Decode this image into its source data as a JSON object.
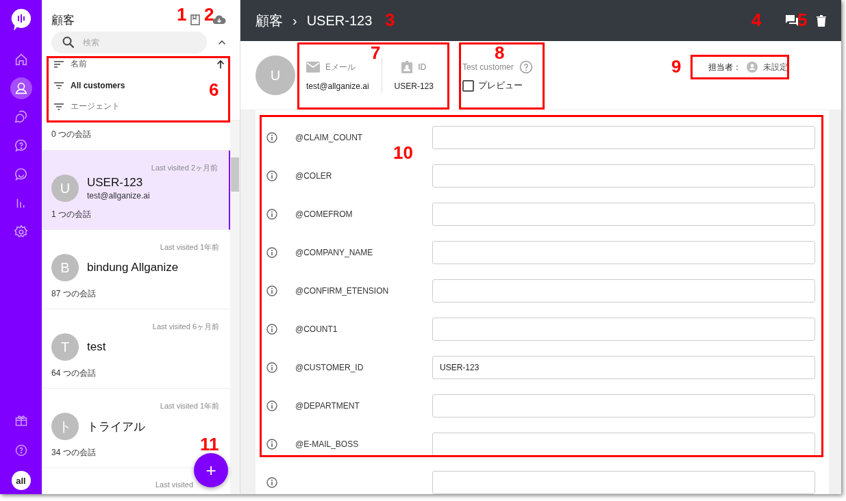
{
  "nav": {
    "items": [
      {
        "selected": false
      },
      {
        "selected": true
      },
      {
        "selected": false
      },
      {
        "selected": false
      },
      {
        "selected": false
      },
      {
        "selected": false
      },
      {
        "selected": false
      }
    ],
    "account": "all"
  },
  "sidebar": {
    "title": "顧客",
    "search": {
      "placeholder": "検索"
    },
    "sort": {
      "label": "名前"
    },
    "filters": [
      {
        "label": "All customers",
        "active": true
      },
      {
        "label": "エージェント",
        "active": false
      }
    ],
    "partial_item": {
      "conversations": "0 つの会話"
    },
    "customers": [
      {
        "initial": "U",
        "name": "USER-123",
        "email": "test@allganize.ai",
        "visited": "Last visited 2ヶ月前",
        "conversations": "1 つの会話",
        "selected": true
      },
      {
        "initial": "B",
        "name": "bindung Allganize",
        "visited": "Last visited 1年前",
        "conversations": "87 つの会話",
        "selected": false
      },
      {
        "initial": "T",
        "name": "test",
        "visited": "Last visited 6ヶ月前",
        "conversations": "64 つの会話",
        "selected": false
      },
      {
        "initial": "ト",
        "name": "トライアル",
        "visited": "Last visited 1年前",
        "conversations": "34 つの会話",
        "selected": false
      },
      {
        "visited": "Last visited",
        "selected": false
      }
    ],
    "add_button": "+"
  },
  "header": {
    "breadcrumb": [
      "顧客",
      "USER-123"
    ],
    "separator": "›"
  },
  "profile": {
    "initial": "U",
    "email": {
      "label": "Eメール",
      "value": "test@allganize.ai"
    },
    "id": {
      "label": "ID",
      "value": "USER-123"
    },
    "test_customer": {
      "label": "Test customer",
      "checkbox_label": "プレビュー",
      "checked": false
    },
    "assignee": {
      "label": "担当者：",
      "value": "未設定"
    }
  },
  "fields": [
    {
      "label": "@CLAIM_COUNT"
    },
    {
      "label": "@COLER"
    },
    {
      "label": "@COMEFROM"
    },
    {
      "label": "@COMPANY_NAME"
    },
    {
      "label": "@CONFIRM_ETENSION"
    },
    {
      "label": "@COUNT1"
    },
    {
      "label": "@CUSTOMER_ID",
      "value": "USER-123"
    },
    {
      "label": "@DEPARTMENT"
    },
    {
      "label": "@E-MAIL_BOSS"
    }
  ],
  "blank_field_row": true,
  "annotations": [
    {
      "label": "1",
      "kind": "number"
    },
    {
      "label": "2",
      "kind": "number"
    },
    {
      "label": "3",
      "kind": "number"
    },
    {
      "label": "4",
      "kind": "number"
    },
    {
      "label": "5",
      "kind": "number"
    },
    {
      "label": "6",
      "kind": "boxed"
    },
    {
      "label": "7",
      "kind": "boxed"
    },
    {
      "label": "8",
      "kind": "boxed"
    },
    {
      "label": "9",
      "kind": "boxed"
    },
    {
      "label": "10",
      "kind": "boxed"
    },
    {
      "label": "11",
      "kind": "number"
    }
  ]
}
